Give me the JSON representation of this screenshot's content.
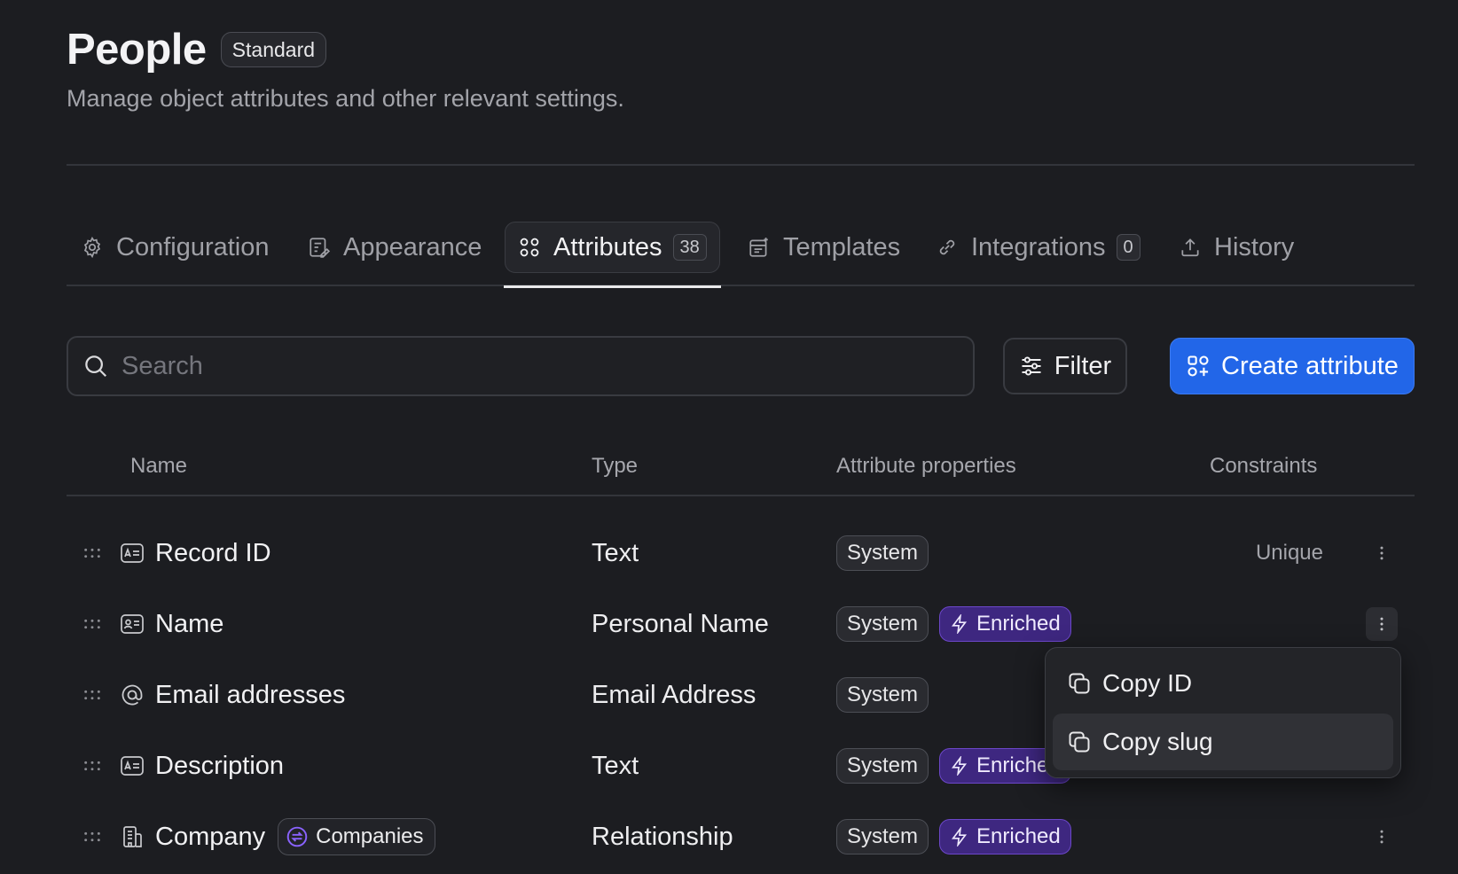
{
  "header": {
    "title": "People",
    "badge": "Standard",
    "subtitle": "Manage object attributes and other relevant settings."
  },
  "tabs": [
    {
      "label": "Configuration",
      "icon": "gear-icon",
      "active": false
    },
    {
      "label": "Appearance",
      "icon": "palette-card-icon",
      "active": false
    },
    {
      "label": "Attributes",
      "icon": "grid-circles-icon",
      "active": true,
      "count": "38"
    },
    {
      "label": "Templates",
      "icon": "templates-icon",
      "active": false
    },
    {
      "label": "Integrations",
      "icon": "link-icon",
      "active": false,
      "count": "0"
    },
    {
      "label": "History",
      "icon": "upload-icon",
      "active": false
    }
  ],
  "toolbar": {
    "search_placeholder": "Search",
    "filter_label": "Filter",
    "create_label": "Create attribute"
  },
  "table": {
    "headers": {
      "name": "Name",
      "type": "Type",
      "properties": "Attribute properties",
      "constraints": "Constraints"
    },
    "rows": [
      {
        "name": "Record ID",
        "icon": "text-field-icon",
        "type": "Text",
        "props": [
          "System"
        ],
        "constraint": "Unique"
      },
      {
        "name": "Name",
        "icon": "id-card-icon",
        "type": "Personal Name",
        "props": [
          "System",
          "Enriched"
        ],
        "constraint": ""
      },
      {
        "name": "Email addresses",
        "icon": "at-sign-icon",
        "type": "Email Address",
        "props": [
          "System"
        ],
        "constraint": ""
      },
      {
        "name": "Description",
        "icon": "text-field-icon",
        "type": "Text",
        "props": [
          "System",
          "Enriched"
        ],
        "constraint": ""
      },
      {
        "name": "Company",
        "icon": "building-icon",
        "chip": "Companies",
        "type": "Relationship",
        "props": [
          "System",
          "Enriched"
        ],
        "constraint": ""
      }
    ]
  },
  "context_menu": {
    "items": [
      {
        "label": "Copy ID",
        "icon": "copy-icon"
      },
      {
        "label": "Copy slug",
        "icon": "copy-icon",
        "highlighted": true
      }
    ]
  },
  "colors": {
    "background": "#1c1d21",
    "accent": "#2266e8",
    "enriched": "#3e2780"
  }
}
